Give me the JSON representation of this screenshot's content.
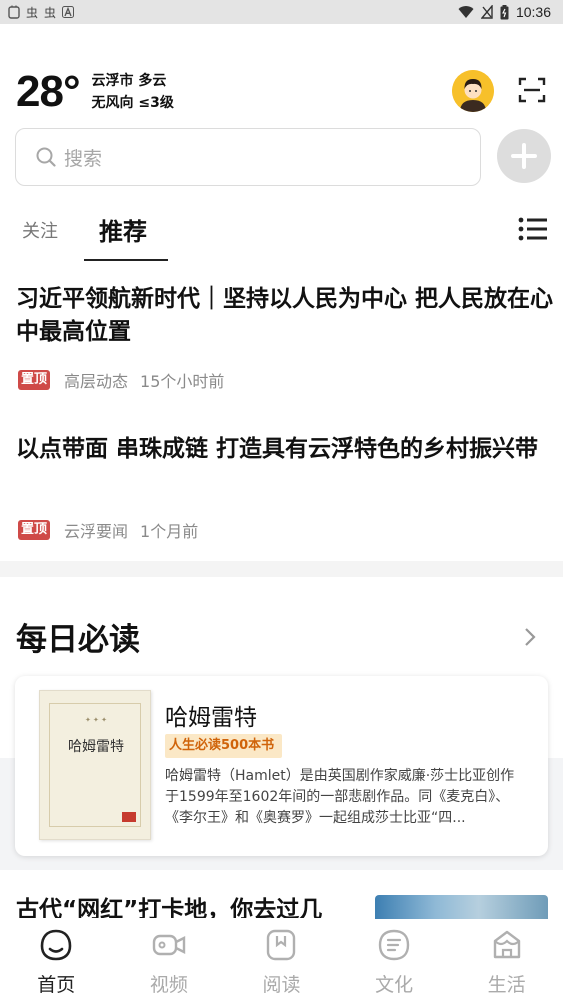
{
  "status_bar": {
    "time": "10:36",
    "left_icons": [
      "虫",
      "虫"
    ]
  },
  "weather": {
    "temperature": "28°",
    "location_condition": "云浮市 多云",
    "wind": "无风向 ≤3级"
  },
  "search": {
    "placeholder": "搜索"
  },
  "tabs": {
    "follow": "关注",
    "recommend": "推荐"
  },
  "news": [
    {
      "title": "习近平领航新时代｜坚持以人民为中心 把人民放在心中最高位置",
      "badge": "置顶",
      "source": "高层动态",
      "time": "15个小时前"
    },
    {
      "title": "以点带面 串珠成链 打造具有云浮特色的乡村振兴带",
      "badge": "置顶",
      "source": "云浮要闻",
      "time": "1个月前"
    }
  ],
  "daily": {
    "heading": "每日必读",
    "book": {
      "title": "哈姆雷特",
      "cover_title": "哈姆雷特",
      "tag": "人生必读500本书",
      "description": "哈姆雷特（Hamlet）是由英国剧作家威廉·莎士比亚创作于1599年至1602年间的一部悲剧作品。同《麦克白》、《李尔王》和《奥赛罗》一起组成莎士比亚“四..."
    }
  },
  "article_preview": {
    "title": "古代“网红”打卡地，你去过几"
  },
  "bottom_nav": [
    {
      "label": "首页",
      "icon": "home-icon",
      "active": true
    },
    {
      "label": "视频",
      "icon": "video-icon",
      "active": false
    },
    {
      "label": "阅读",
      "icon": "reading-icon",
      "active": false
    },
    {
      "label": "文化",
      "icon": "culture-icon",
      "active": false
    },
    {
      "label": "生活",
      "icon": "life-icon",
      "active": false
    }
  ],
  "colors": {
    "pin_badge": "#cf4a48",
    "avatar_bg": "#f7c02a",
    "tag_text": "#d0640b",
    "tag_bg": "#fbe8c6"
  }
}
